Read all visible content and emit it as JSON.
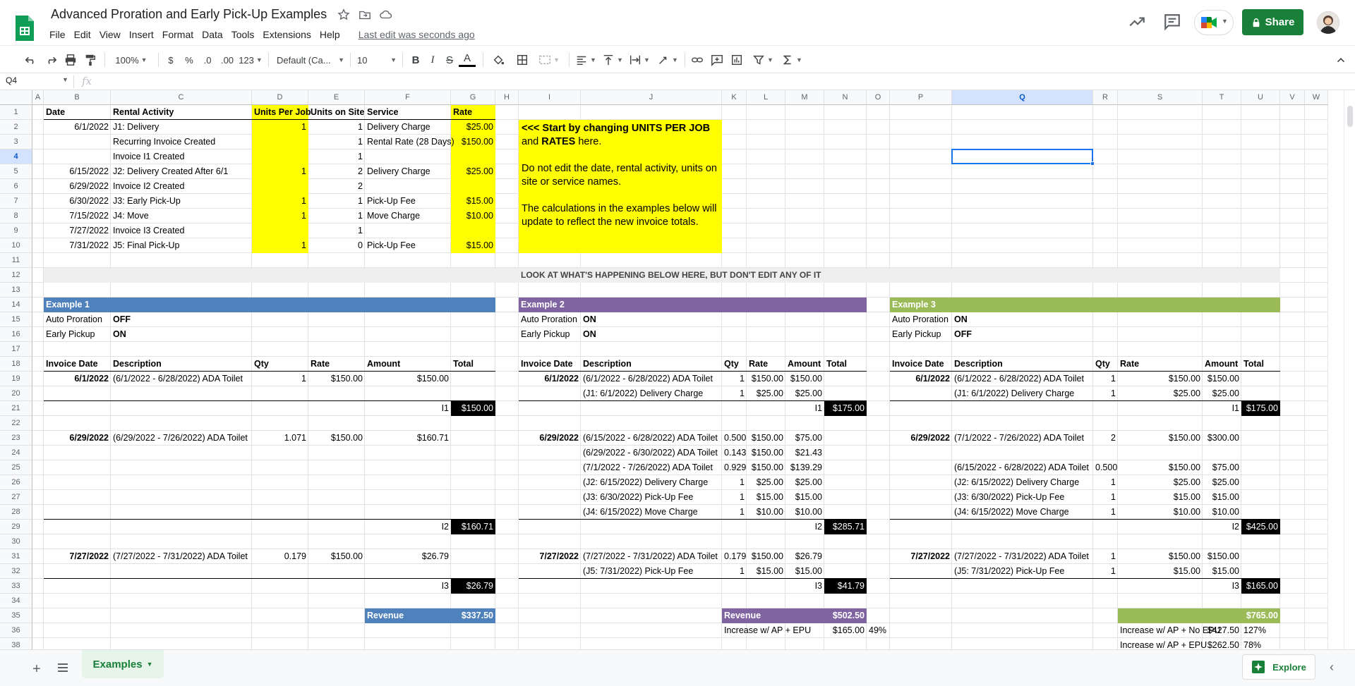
{
  "doc": {
    "title": "Advanced Proration and Early Pick-Up Examples",
    "last_edit": "Last edit was seconds ago"
  },
  "menu": [
    "File",
    "Edit",
    "View",
    "Insert",
    "Format",
    "Data",
    "Tools",
    "Extensions",
    "Help"
  ],
  "header_actions": {
    "share_label": "Share"
  },
  "toolbar": {
    "zoom": "100%",
    "currency": "$",
    "percent": "%",
    "decrease_decimal": ".0",
    "increase_decimal": ".00",
    "more_formats": "123",
    "font": "Default (Ca...",
    "font_size": "10",
    "bold": "B",
    "italic": "I",
    "strike": "S",
    "text_color": "A"
  },
  "formula_bar": {
    "name_box": "Q4",
    "fx": "fx",
    "content": ""
  },
  "columns": [
    "A",
    "B",
    "C",
    "D",
    "E",
    "F",
    "G",
    "H",
    "I",
    "J",
    "K",
    "L",
    "M",
    "N",
    "O",
    "P",
    "Q",
    "R",
    "S",
    "T",
    "U",
    "V",
    "W"
  ],
  "rows": [
    "1",
    "2",
    "3",
    "4",
    "5",
    "6",
    "7",
    "8",
    "9",
    "10",
    "11",
    "12",
    "13",
    "14",
    "15",
    "16",
    "17",
    "18",
    "19",
    "20",
    "21",
    "22",
    "23",
    "24",
    "25",
    "26",
    "27",
    "28",
    "29",
    "30",
    "31",
    "32",
    "33",
    "34",
    "35",
    "36",
    "38"
  ],
  "input_table": {
    "headers": {
      "date": "Date",
      "activity": "Rental Activity",
      "units_per_job": "Units Per Job",
      "units_on_site": "Units on Site",
      "service": "Service",
      "rate": "Rate"
    },
    "rows": [
      {
        "date": "6/1/2022",
        "activity": "J1: Delivery",
        "units_per_job": "1",
        "units_on_site": "1",
        "service": "Delivery Charge",
        "rate": "$25.00"
      },
      {
        "date": "",
        "activity": "Recurring Invoice Created",
        "units_per_job": "",
        "units_on_site": "1",
        "service": "Rental Rate (28 Days)",
        "rate": "$150.00"
      },
      {
        "date": "",
        "activity": "Invoice I1 Created",
        "units_per_job": "",
        "units_on_site": "1",
        "service": "",
        "rate": ""
      },
      {
        "date": "6/15/2022",
        "activity": "J2: Delivery Created After 6/1",
        "units_per_job": "1",
        "units_on_site": "2",
        "service": "Delivery Charge",
        "rate": "$25.00"
      },
      {
        "date": "6/29/2022",
        "activity": "Invoice I2 Created",
        "units_per_job": "",
        "units_on_site": "2",
        "service": "",
        "rate": ""
      },
      {
        "date": "6/30/2022",
        "activity": "J3: Early Pick-Up",
        "units_per_job": "1",
        "units_on_site": "1",
        "service": "Pick-Up Fee",
        "rate": "$15.00"
      },
      {
        "date": "7/15/2022",
        "activity": "J4: Move",
        "units_per_job": "1",
        "units_on_site": "1",
        "service": "Move Charge",
        "rate": "$10.00"
      },
      {
        "date": "7/27/2022",
        "activity": "Invoice I3 Created",
        "units_per_job": "",
        "units_on_site": "1",
        "service": "",
        "rate": ""
      },
      {
        "date": "7/31/2022",
        "activity": "J5: Final Pick-Up",
        "units_per_job": "1",
        "units_on_site": "0",
        "service": "Pick-Up Fee",
        "rate": "$15.00"
      }
    ]
  },
  "note": {
    "prefix": "<<<  Start by changing ",
    "em1": "UNITS PER JOB",
    "mid": " and ",
    "em2": "RATES",
    "suffix": " here.",
    "p2": "Do not edit the date, rental activity, units on site or service names.",
    "p3": "The calculations in the examples below will update to reflect the new invoice totals."
  },
  "banner": "LOOK AT WHAT'S HAPPENING BELOW HERE, BUT DON'T EDIT ANY OF IT",
  "colors": {
    "yellow": "#ffff00",
    "example1": "#4f81bd",
    "example2": "#8064a2",
    "example3": "#9bbb59",
    "banner": "#efefef",
    "total_bg": "#000000",
    "share_green": "#188038"
  },
  "labels": {
    "auto_proration": "Auto Proration",
    "early_pickup": "Early Pickup",
    "invoice_date": "Invoice Date",
    "description": "Description",
    "qty": "Qty",
    "rate": "Rate",
    "amount": "Amount",
    "total": "Total",
    "revenue": "Revenue",
    "increase_ap_no_epu": "Increase w/ AP + No EPU",
    "increase_ap_epu_2": "Increase w/ AP + EPU",
    "increase_ap_epu": "Increase w/ AP + EPU"
  },
  "examples": {
    "ex1": {
      "title": "Example 1",
      "auto_proration": "OFF",
      "early_pickup": "ON",
      "i1": {
        "date": "6/1/2022",
        "lines": [
          {
            "desc": "(6/1/2022 - 6/28/2022) ADA Toilet",
            "qty": "1",
            "rate": "$150.00",
            "amount": "$150.00"
          }
        ],
        "label": "I1",
        "total": "$150.00"
      },
      "i2": {
        "date": "6/29/2022",
        "lines": [
          {
            "desc": "(6/29/2022 - 7/26/2022) ADA Toilet",
            "qty": "1.071",
            "rate": "$150.00",
            "amount": "$160.71"
          }
        ],
        "label": "I2",
        "total": "$160.71"
      },
      "i3": {
        "date": "7/27/2022",
        "lines": [
          {
            "desc": "(7/27/2022 - 7/31/2022) ADA Toilet",
            "qty": "0.179",
            "rate": "$150.00",
            "amount": "$26.79"
          }
        ],
        "label": "I3",
        "total": "$26.79"
      },
      "revenue": "$337.50"
    },
    "ex2": {
      "title": "Example 2",
      "auto_proration": "ON",
      "early_pickup": "ON",
      "i1": {
        "date": "6/1/2022",
        "lines": [
          {
            "desc": "(6/1/2022 - 6/28/2022) ADA Toilet",
            "qty": "1",
            "rate": "$150.00",
            "amount": "$150.00"
          },
          {
            "desc": "(J1: 6/1/2022) Delivery Charge",
            "qty": "1",
            "rate": "$25.00",
            "amount": "$25.00"
          }
        ],
        "label": "I1",
        "total": "$175.00"
      },
      "i2": {
        "date": "6/29/2022",
        "lines": [
          {
            "desc": "(6/15/2022 - 6/28/2022) ADA Toilet",
            "qty": "0.500",
            "rate": "$150.00",
            "amount": "$75.00"
          },
          {
            "desc": "(6/29/2022 - 6/30/2022) ADA Toilet",
            "qty": "0.143",
            "rate": "$150.00",
            "amount": "$21.43"
          },
          {
            "desc": "(7/1/2022 - 7/26/2022) ADA Toilet",
            "qty": "0.929",
            "rate": "$150.00",
            "amount": "$139.29"
          },
          {
            "desc": "(J2: 6/15/2022) Delivery Charge",
            "qty": "1",
            "rate": "$25.00",
            "amount": "$25.00"
          },
          {
            "desc": "(J3: 6/30/2022) Pick-Up Fee",
            "qty": "1",
            "rate": "$15.00",
            "amount": "$15.00"
          },
          {
            "desc": "(J4: 6/15/2022) Move Charge",
            "qty": "1",
            "rate": "$10.00",
            "amount": "$10.00"
          }
        ],
        "label": "I2",
        "total": "$285.71"
      },
      "i3": {
        "date": "7/27/2022",
        "lines": [
          {
            "desc": "(7/27/2022 - 7/31/2022) ADA Toilet",
            "qty": "0.179",
            "rate": "$150.00",
            "amount": "$26.79"
          },
          {
            "desc": "(J5: 7/31/2022) Pick-Up Fee",
            "qty": "1",
            "rate": "$15.00",
            "amount": "$15.00"
          }
        ],
        "label": "I3",
        "total": "$41.79"
      },
      "revenue": "$502.50",
      "increase_amount": "$165.00",
      "increase_pct": "49%"
    },
    "ex3": {
      "title": "Example 3",
      "auto_proration": "ON",
      "early_pickup": "OFF",
      "i1": {
        "date": "6/1/2022",
        "lines": [
          {
            "desc": "(6/1/2022 - 6/28/2022) ADA Toilet",
            "qty": "1",
            "rate": "$150.00",
            "amount": "$150.00"
          },
          {
            "desc": "(J1: 6/1/2022) Delivery Charge",
            "qty": "1",
            "rate": "$25.00",
            "amount": "$25.00"
          }
        ],
        "label": "I1",
        "total": "$175.00"
      },
      "i2": {
        "date": "6/29/2022",
        "lines": [
          {
            "desc": "(7/1/2022 - 7/26/2022) ADA Toilet",
            "qty": "2",
            "rate": "$150.00",
            "amount": "$300.00"
          },
          {
            "desc": "",
            "qty": "",
            "rate": "",
            "amount": ""
          },
          {
            "desc": "(6/15/2022 - 6/28/2022) ADA Toilet",
            "qty": "0.500",
            "rate": "$150.00",
            "amount": "$75.00"
          },
          {
            "desc": "(J2: 6/15/2022) Delivery Charge",
            "qty": "1",
            "rate": "$25.00",
            "amount": "$25.00"
          },
          {
            "desc": "(J3: 6/30/2022) Pick-Up Fee",
            "qty": "1",
            "rate": "$15.00",
            "amount": "$15.00"
          },
          {
            "desc": "(J4: 6/15/2022) Move Charge",
            "qty": "1",
            "rate": "$10.00",
            "amount": "$10.00"
          }
        ],
        "label": "I2",
        "total": "$425.00"
      },
      "i3": {
        "date": "7/27/2022",
        "lines": [
          {
            "desc": "(7/27/2022 - 7/31/2022) ADA Toilet",
            "qty": "1",
            "rate": "$150.00",
            "amount": "$150.00"
          },
          {
            "desc": "(J5: 7/31/2022) Pick-Up Fee",
            "qty": "1",
            "rate": "$15.00",
            "amount": "$15.00"
          }
        ],
        "label": "I3",
        "total": "$165.00"
      },
      "revenue": "$765.00",
      "increase_no_epu_amount": "$427.50",
      "increase_no_epu_pct": "127%",
      "increase_epu_amount": "$262.50",
      "increase_epu_pct": "78%"
    }
  },
  "sheet_tab": "Examples",
  "explore_label": "Explore"
}
